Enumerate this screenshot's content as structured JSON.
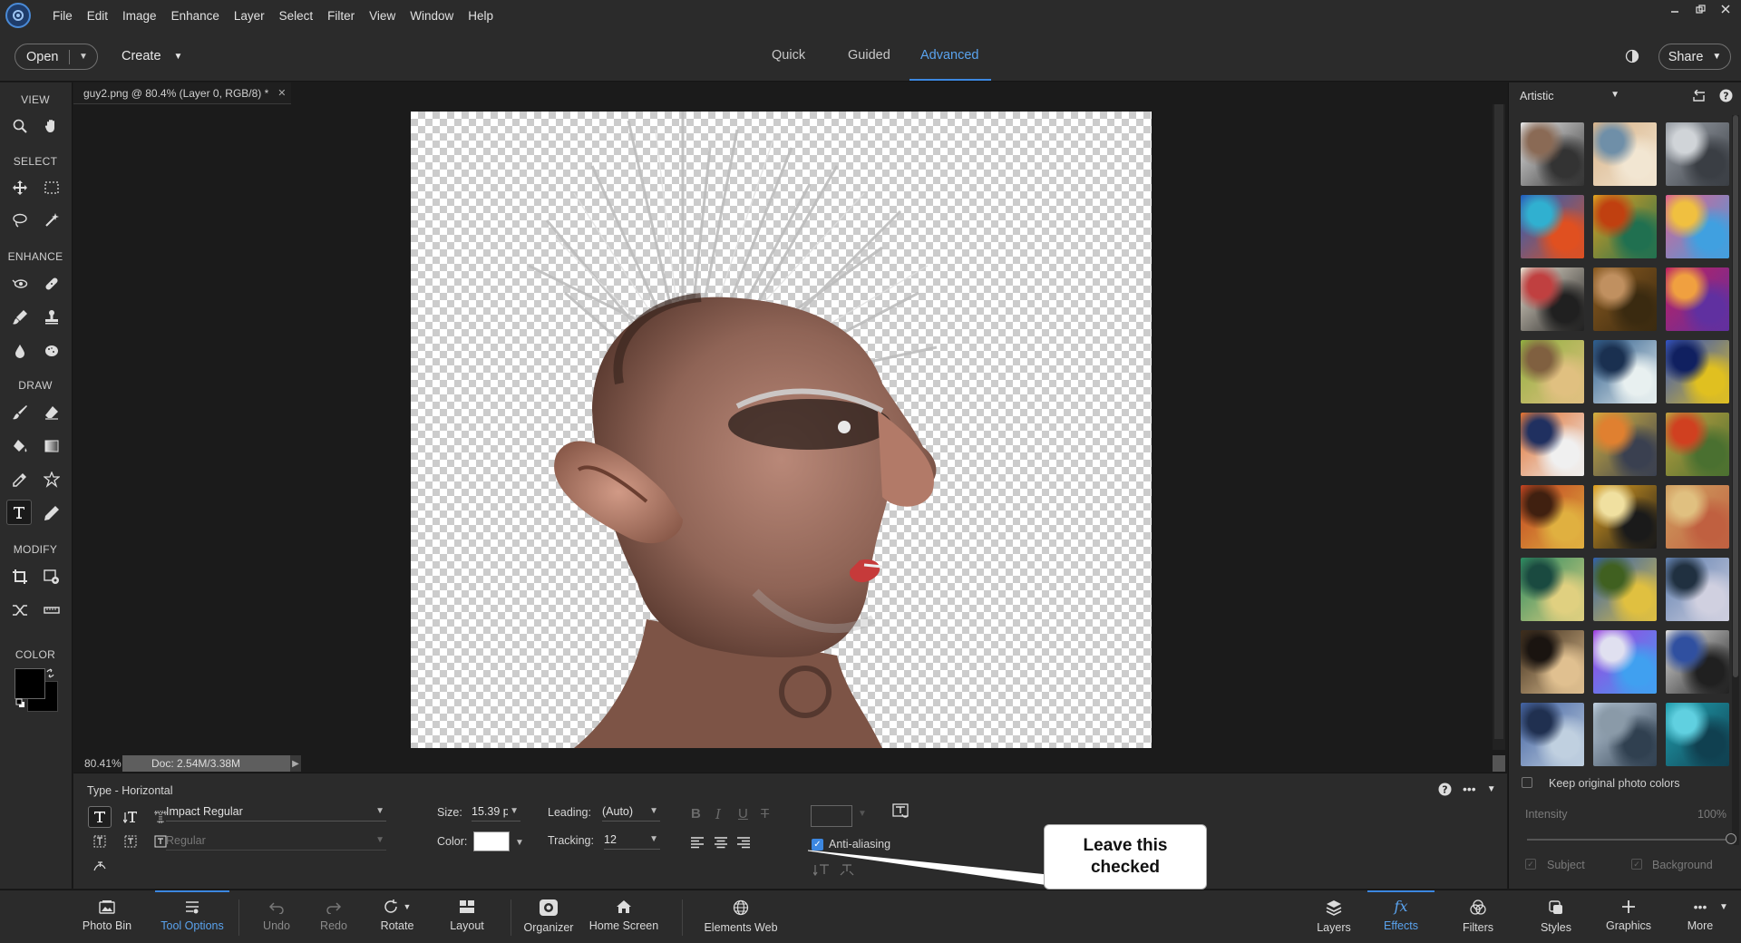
{
  "menubar": {
    "items": [
      "File",
      "Edit",
      "Image",
      "Enhance",
      "Layer",
      "Select",
      "Filter",
      "View",
      "Window",
      "Help"
    ]
  },
  "modebar": {
    "open_label": "Open",
    "create_label": "Create",
    "tabs": [
      "Quick",
      "Guided",
      "Advanced"
    ],
    "active_tab": "Advanced",
    "share_label": "Share"
  },
  "toolbox": {
    "sections": [
      "VIEW",
      "SELECT",
      "ENHANCE",
      "DRAW",
      "MODIFY",
      "COLOR"
    ],
    "tools": [
      "zoom",
      "hand",
      "move",
      "marquee",
      "lasso",
      "magic-wand",
      "red-eye",
      "spot-healing",
      "smart-brush",
      "clone-stamp",
      "blur",
      "sponge",
      "brush",
      "eraser",
      "paint-bucket",
      "gradient",
      "eyedropper",
      "custom-shape",
      "type",
      "pencil",
      "crop",
      "recompose",
      "content-aware-move",
      "straighten"
    ],
    "selected_tool": "type",
    "foreground_color": "#000000",
    "background_color": "#000000"
  },
  "document": {
    "tab_title": "guy2.png @ 80.4% (Layer 0, RGB/8) *",
    "zoom": "80.41%",
    "doc_size": "Doc: 2.54M/3.38M"
  },
  "tool_options": {
    "mode_label": "Type - Horizontal",
    "font_family": "Impact Regular",
    "font_style": "Regular",
    "size_label": "Size:",
    "size_value": "15.39 p",
    "leading_label": "Leading:",
    "leading_value": "(Auto)",
    "tracking_label": "Tracking:",
    "tracking_value": "12",
    "color_label": "Color:",
    "text_color": "#ffffff",
    "anti_aliasing_label": "Anti-aliasing",
    "anti_aliasing_checked": true
  },
  "callout": {
    "text": "Leave this\nchecked"
  },
  "taskbar": {
    "left": [
      {
        "label": "Photo Bin",
        "icon": "photo-bin-icon"
      },
      {
        "label": "Tool Options",
        "icon": "tool-options-icon",
        "active": true
      },
      {
        "label": "Undo",
        "icon": "undo-icon",
        "disabled": true
      },
      {
        "label": "Redo",
        "icon": "redo-icon",
        "disabled": true
      },
      {
        "label": "Rotate",
        "icon": "rotate-icon"
      },
      {
        "label": "Layout",
        "icon": "layout-icon"
      },
      {
        "label": "Organizer",
        "icon": "organizer-icon"
      },
      {
        "label": "Home Screen",
        "icon": "home-icon"
      },
      {
        "label": "Elements Web",
        "icon": "globe-icon"
      }
    ],
    "right": [
      {
        "label": "Layers",
        "icon": "layers-icon"
      },
      {
        "label": "Effects",
        "icon": "fx-icon",
        "active": true
      },
      {
        "label": "Filters",
        "icon": "filters-icon"
      },
      {
        "label": "Styles",
        "icon": "styles-icon"
      },
      {
        "label": "Graphics",
        "icon": "plus-icon"
      },
      {
        "label": "More",
        "icon": "more-icon"
      }
    ]
  },
  "effects_panel": {
    "category": "Artistic",
    "thumbnails": [
      {
        "c1": "#e8e8e8",
        "c2": "#333333",
        "c3": "#8a6a55"
      },
      {
        "c1": "#d9b48a",
        "c2": "#f2e6d2",
        "c3": "#6f8fa8"
      },
      {
        "c1": "#9aa0a8",
        "c2": "#3a3e44",
        "c3": "#d0d4d8"
      },
      {
        "c1": "#2060c0",
        "c2": "#e05020",
        "c3": "#30b0d0"
      },
      {
        "c1": "#e0a020",
        "c2": "#207050",
        "c3": "#c04010"
      },
      {
        "c1": "#e06090",
        "c2": "#40a0e0",
        "c3": "#f0c040"
      },
      {
        "c1": "#e8e0d0",
        "c2": "#202020",
        "c3": "#c04040"
      },
      {
        "c1": "#8a5a20",
        "c2": "#3a2a10",
        "c3": "#c09060"
      },
      {
        "c1": "#c02060",
        "c2": "#6030a0",
        "c3": "#f0a040"
      },
      {
        "c1": "#90b040",
        "c2": "#e0c080",
        "c3": "#806040"
      },
      {
        "c1": "#2a5a8a",
        "c2": "#e8f0f0",
        "c3": "#1a3050"
      },
      {
        "c1": "#3050c0",
        "c2": "#e0c020",
        "c3": "#102060"
      },
      {
        "c1": "#e07030",
        "c2": "#f0f0f0",
        "c3": "#203060"
      },
      {
        "c1": "#d0b040",
        "c2": "#3a4050",
        "c3": "#e08030"
      },
      {
        "c1": "#c0a040",
        "c2": "#4a7030",
        "c3": "#d04020"
      },
      {
        "c1": "#c04020",
        "c2": "#e0b040",
        "c3": "#402010"
      },
      {
        "c1": "#e0a020",
        "c2": "#1a1a1a",
        "c3": "#f0e0a0"
      },
      {
        "c1": "#d0a060",
        "c2": "#c06040",
        "c3": "#e0c080"
      },
      {
        "c1": "#2a8a60",
        "c2": "#e0d080",
        "c3": "#1a4a40"
      },
      {
        "c1": "#3060b0",
        "c2": "#e0c040",
        "c3": "#406020"
      },
      {
        "c1": "#6080b0",
        "c2": "#d0d0e0",
        "c3": "#203040"
      },
      {
        "c1": "#3a2a1a",
        "c2": "#e0c090",
        "c3": "#1a1410"
      },
      {
        "c1": "#a040e0",
        "c2": "#40a0f0",
        "c3": "#e0e0f0"
      },
      {
        "c1": "#e0e0e0",
        "c2": "#202020",
        "c3": "#3050a0"
      },
      {
        "c1": "#4060a0",
        "c2": "#c0d0e0",
        "c3": "#203050"
      },
      {
        "c1": "#c0d0e0",
        "c2": "#304050",
        "c3": "#8a9aa8"
      },
      {
        "c1": "#20a0b0",
        "c2": "#104050",
        "c3": "#60d0e0"
      }
    ],
    "keep_colors_label": "Keep original photo colors",
    "intensity_label": "Intensity",
    "intensity_value": "100%",
    "intensity_fraction": 1.0,
    "subject_label": "Subject",
    "background_label": "Background"
  }
}
